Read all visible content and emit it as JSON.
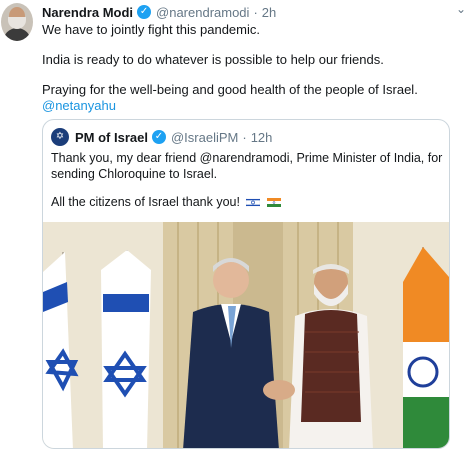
{
  "tweet": {
    "author_name": "Narendra Modi",
    "handle": "@narendramodi",
    "time": "2h",
    "separator": "·",
    "lines": [
      "We have to jointly fight this pandemic.",
      "India is ready to do whatever is possible to help our friends.",
      "Praying for the well-being and good health of the people of Israel."
    ],
    "mention": "@netanyahu",
    "caret": "⌄",
    "verified_glyph": "✓"
  },
  "quoted": {
    "author_name": "PM of Israel",
    "handle": "@IsraeliPM",
    "time": "12h",
    "separator": "·",
    "avatar_glyph": "✡",
    "verified_glyph": "✓",
    "lines": [
      "Thank you, my dear friend @narendramodi, Prime Minister of India, for",
      "sending Chloroquine to Israel.",
      "All the citizens of Israel thank you!"
    ],
    "flags": [
      "israel-flag",
      "india-flag"
    ]
  },
  "colors": {
    "link": "#1b95e0",
    "verified": "#1da1f2",
    "muted": "#657786"
  }
}
